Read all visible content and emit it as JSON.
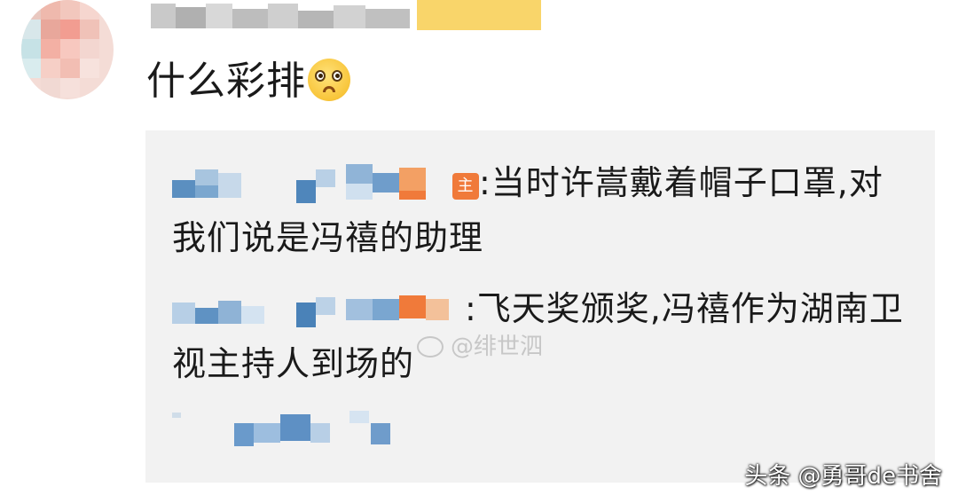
{
  "post": {
    "comment_text": "什么彩排",
    "emoji": "pleading-face-emoji"
  },
  "replies": [
    {
      "owner_badge": "主",
      "text": ":当时许嵩戴着帽子口罩,对我们说是冯禧的助理"
    },
    {
      "text": ":飞天奖颁奖,冯禧作为湖南卫视主持人到场的"
    }
  ],
  "watermarks": {
    "middle": "@绯世泗",
    "source": "头条 @勇哥de书舍"
  },
  "colors": {
    "reply_background": "#f2f2f2",
    "badge_yellow": "#f9d56a",
    "owner_badge_orange": "#f07a3a"
  }
}
